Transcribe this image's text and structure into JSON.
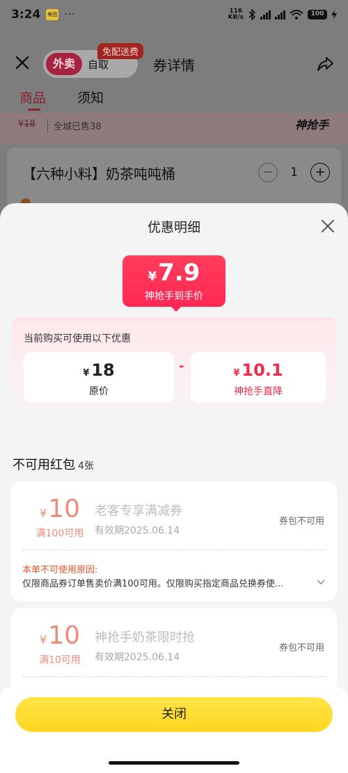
{
  "status": {
    "time": "3:24",
    "app_badge": "美团",
    "dots": "···",
    "net_speed_value": "116",
    "net_speed_unit": "KB/s",
    "battery": "100"
  },
  "header": {
    "tab_delivery": "外卖",
    "tab_pickup": "自取",
    "promo_tag": "免配送费",
    "title": "券详情"
  },
  "tabs": {
    "goods": "商品",
    "notice": "须知"
  },
  "peek": {
    "old_price": "¥18",
    "sold": "全城已售38",
    "brand_logo": "神抢手"
  },
  "product": {
    "name": "【六种小料】奶茶吨吨桶",
    "quantity": "1",
    "minus": "−",
    "plus": "+"
  },
  "sheet": {
    "title": "优惠明细",
    "deal_currency": "¥",
    "deal_price": "7.9",
    "deal_label": "神抢手到手价",
    "intro": "当前购买可使用以下优惠",
    "original": {
      "currency": "¥",
      "amount": "18",
      "label": "原价"
    },
    "minus_sign": "-",
    "discount": {
      "currency": "¥",
      "amount": "10.1",
      "label": "神抢手直降"
    },
    "unusable_title": "不可用红包",
    "unusable_count": "4张",
    "coupons": [
      {
        "currency": "¥",
        "amount": "10",
        "condition": "满100可用",
        "name": "老客专享满减券",
        "valid": "有效期2025.06.14",
        "state": "券包不可用",
        "reason_title": "本单不可使用原因:",
        "reason_text": "仅限商品券订单售卖价满100可用。仅限购买指定商品兑换券使..."
      },
      {
        "currency": "¥",
        "amount": "10",
        "condition": "满10可用",
        "name": "神抢手奶茶限时抢",
        "valid": "有效期2025.06.14",
        "state": "券包不可用"
      }
    ],
    "close_button": "关闭"
  }
}
